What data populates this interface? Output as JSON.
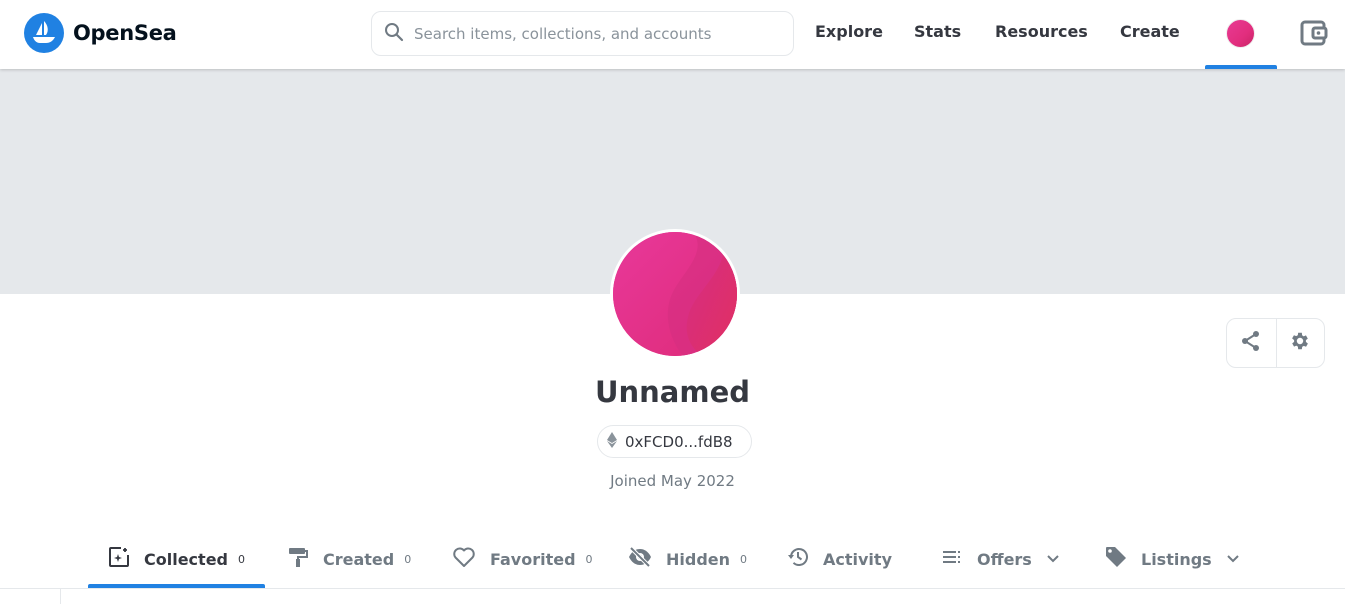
{
  "brand": {
    "name": "OpenSea",
    "accent": "#2081E2"
  },
  "search": {
    "placeholder": "Search items, collections, and accounts",
    "value": ""
  },
  "nav": {
    "links": [
      {
        "label": "Explore"
      },
      {
        "label": "Stats"
      },
      {
        "label": "Resources"
      },
      {
        "label": "Create"
      }
    ],
    "active": "profile"
  },
  "profile": {
    "name": "Unnamed",
    "address": "0xFCD0...fdB8",
    "chain_icon": "ethereum-icon",
    "joined": "Joined May 2022"
  },
  "actions": [
    {
      "icon": "share-icon"
    },
    {
      "icon": "gear-icon"
    }
  ],
  "tabs": [
    {
      "label": "Collected",
      "count": "0",
      "icon": "collected-icon",
      "active": true
    },
    {
      "label": "Created",
      "count": "0",
      "icon": "paint-roller-icon"
    },
    {
      "label": "Favorited",
      "count": "0",
      "icon": "heart-icon"
    },
    {
      "label": "Hidden",
      "count": "0",
      "icon": "eye-off-icon"
    },
    {
      "label": "Activity",
      "icon": "history-icon"
    },
    {
      "label": "Offers",
      "icon": "list-icon",
      "dropdown": true
    },
    {
      "label": "Listings",
      "icon": "tag-icon",
      "dropdown": true
    }
  ]
}
